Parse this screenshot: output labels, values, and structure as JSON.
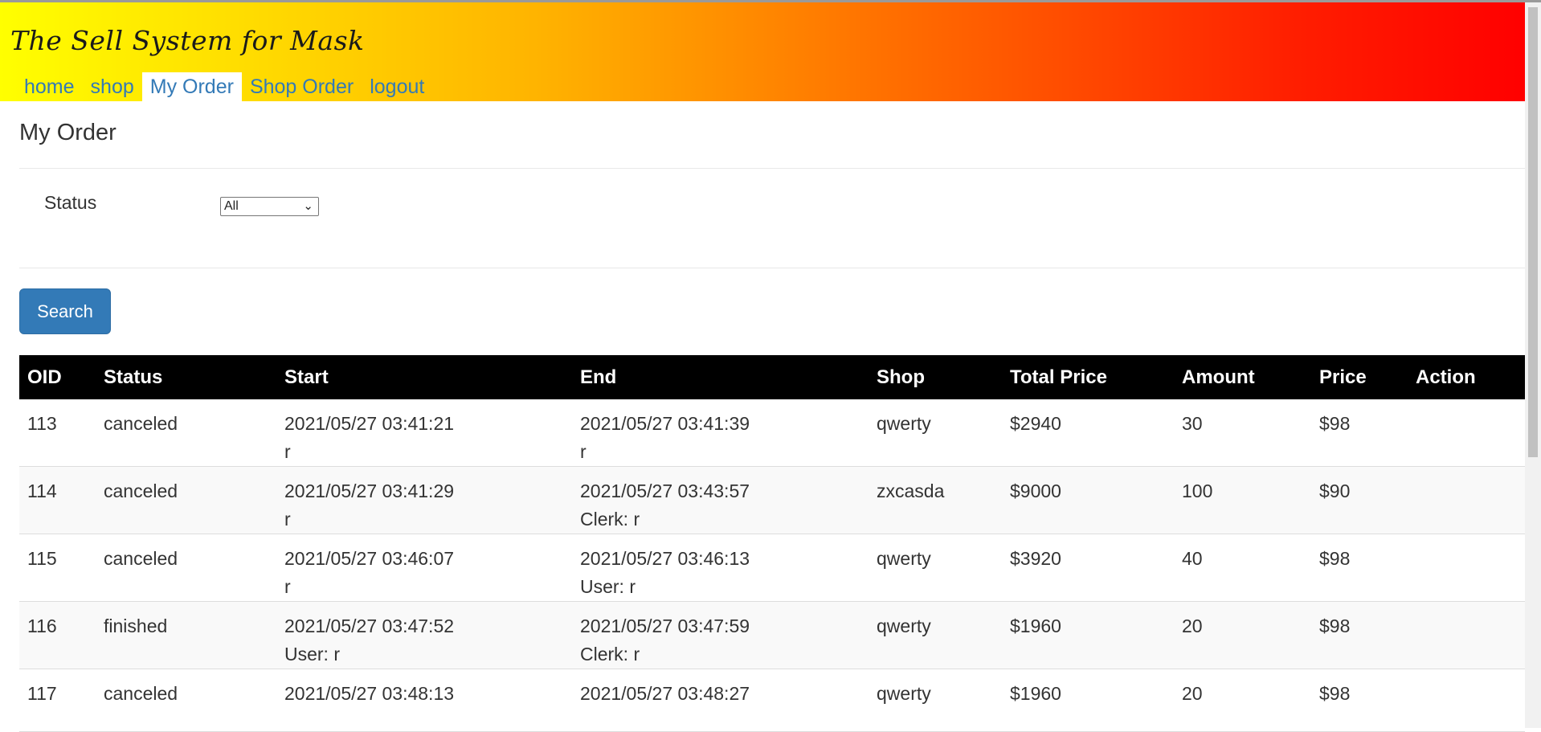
{
  "brand": "The Sell System for Mask",
  "nav": [
    {
      "label": "home"
    },
    {
      "label": "shop"
    },
    {
      "label": "My Order"
    },
    {
      "label": "Shop Order"
    },
    {
      "label": "logout"
    }
  ],
  "page_title": "My Order",
  "filter": {
    "status_label": "Status",
    "status_value": "All"
  },
  "search_label": "Search",
  "table": {
    "headers": [
      "OID",
      "Status",
      "Start",
      "End",
      "Shop",
      "Total Price",
      "Amount",
      "Price",
      "Action"
    ],
    "rows": [
      {
        "oid": "113",
        "status": "canceled",
        "start": "2021/05/27 03:41:21",
        "start_by": "r",
        "end": "2021/05/27 03:41:39",
        "end_by": "r",
        "shop": "qwerty",
        "total": "$2940",
        "amount": "30",
        "price": "$98"
      },
      {
        "oid": "114",
        "status": "canceled",
        "start": "2021/05/27 03:41:29",
        "start_by": "r",
        "end": "2021/05/27 03:43:57",
        "end_by": "Clerk: r",
        "shop": "zxcasda",
        "total": "$9000",
        "amount": "100",
        "price": "$90"
      },
      {
        "oid": "115",
        "status": "canceled",
        "start": "2021/05/27 03:46:07",
        "start_by": "r",
        "end": "2021/05/27 03:46:13",
        "end_by": "User: r",
        "shop": "qwerty",
        "total": "$3920",
        "amount": "40",
        "price": "$98"
      },
      {
        "oid": "116",
        "status": "finished",
        "start": "2021/05/27 03:47:52",
        "start_by": "User: r",
        "end": "2021/05/27 03:47:59",
        "end_by": "Clerk: r",
        "shop": "qwerty",
        "total": "$1960",
        "amount": "20",
        "price": "$98"
      },
      {
        "oid": "117",
        "status": "canceled",
        "start": "2021/05/27 03:48:13",
        "start_by": "",
        "end": "2021/05/27 03:48:27",
        "end_by": "",
        "shop": "qwerty",
        "total": "$1960",
        "amount": "20",
        "price": "$98"
      }
    ]
  }
}
